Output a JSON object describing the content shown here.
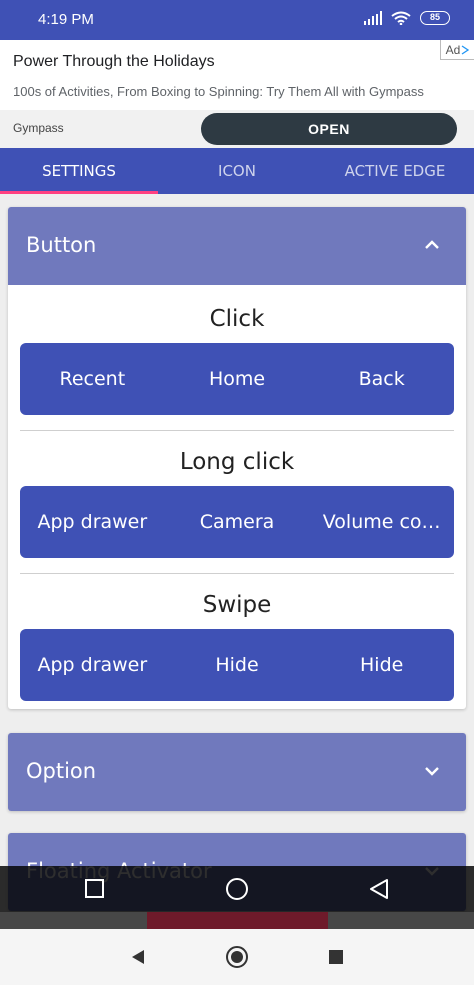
{
  "status_bar": {
    "time": "4:19 PM",
    "battery": "85"
  },
  "ad": {
    "title": "Power Through the Holidays",
    "description": "100s of Activities, From Boxing to Spinning: Try Them All with Gympass",
    "badge": "Ad",
    "advertiser": "Gympass",
    "cta": "OPEN"
  },
  "tabs": [
    {
      "label": "SETTINGS",
      "active": true
    },
    {
      "label": "ICON",
      "active": false
    },
    {
      "label": "ACTIVE EDGE",
      "active": false
    }
  ],
  "button_panel": {
    "title": "Button",
    "expanded": true,
    "click": {
      "title": "Click",
      "options": [
        "Recent",
        "Home",
        "Back"
      ]
    },
    "long_click": {
      "title": "Long click",
      "options": [
        "App drawer",
        "Camera",
        "Volume co…"
      ]
    },
    "swipe": {
      "title": "Swipe",
      "options": [
        "App drawer",
        "Hide",
        "Hide"
      ]
    }
  },
  "option_panel": {
    "title": "Option",
    "expanded": false
  },
  "floating_panel": {
    "title": "Floating Activator",
    "expanded": false
  },
  "colors": {
    "primary": "#3f51b5",
    "panel_header": "#7079bd",
    "tab_indicator": "#ff4081"
  }
}
